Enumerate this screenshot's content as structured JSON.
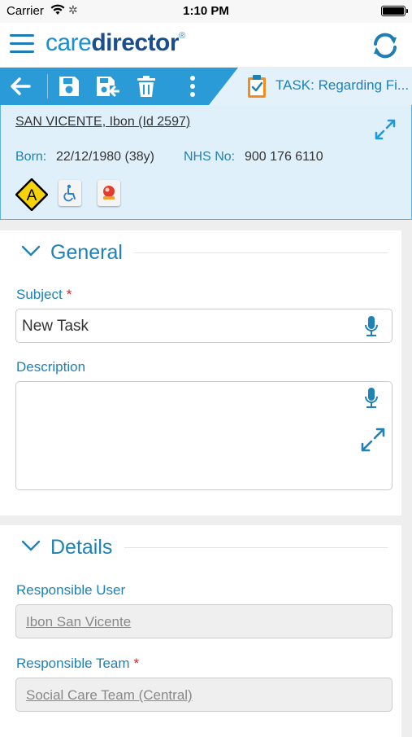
{
  "status_bar": {
    "carrier": "Carrier",
    "time": "1:10 PM"
  },
  "app_bar": {
    "logo_light": "care",
    "logo_bold": "director",
    "logo_mark": "®",
    "menu_icon": "hamburger-icon",
    "sync_icon": "sync-icon"
  },
  "toolbar": {
    "icons": [
      "back-arrow-icon",
      "save-icon",
      "save-and-close-icon",
      "delete-icon",
      "more-vertical-icon"
    ],
    "task_title": "TASK: Regarding Fi..."
  },
  "patient": {
    "name": "SAN VICENTE, Ibon (Id 2597)",
    "born_label": "Born:",
    "born_value": "22/12/1980 (38y)",
    "nhs_label": "NHS No:",
    "nhs_value": "900 176 6110",
    "alert_letter": "A",
    "alert_color": "#f5d20a",
    "accent_color": "#2a9bd6"
  },
  "general": {
    "title": "General",
    "subject_label": "Subject",
    "required_mark": "*",
    "subject_value": "New Task",
    "description_label": "Description",
    "description_value": ""
  },
  "details": {
    "title": "Details",
    "responsible_user_label": "Responsible User",
    "responsible_user_value": "Ibon San Vicente",
    "responsible_team_label": "Responsible Team",
    "required_mark": "*",
    "responsible_team_value": "Social Care Team (Central)"
  }
}
